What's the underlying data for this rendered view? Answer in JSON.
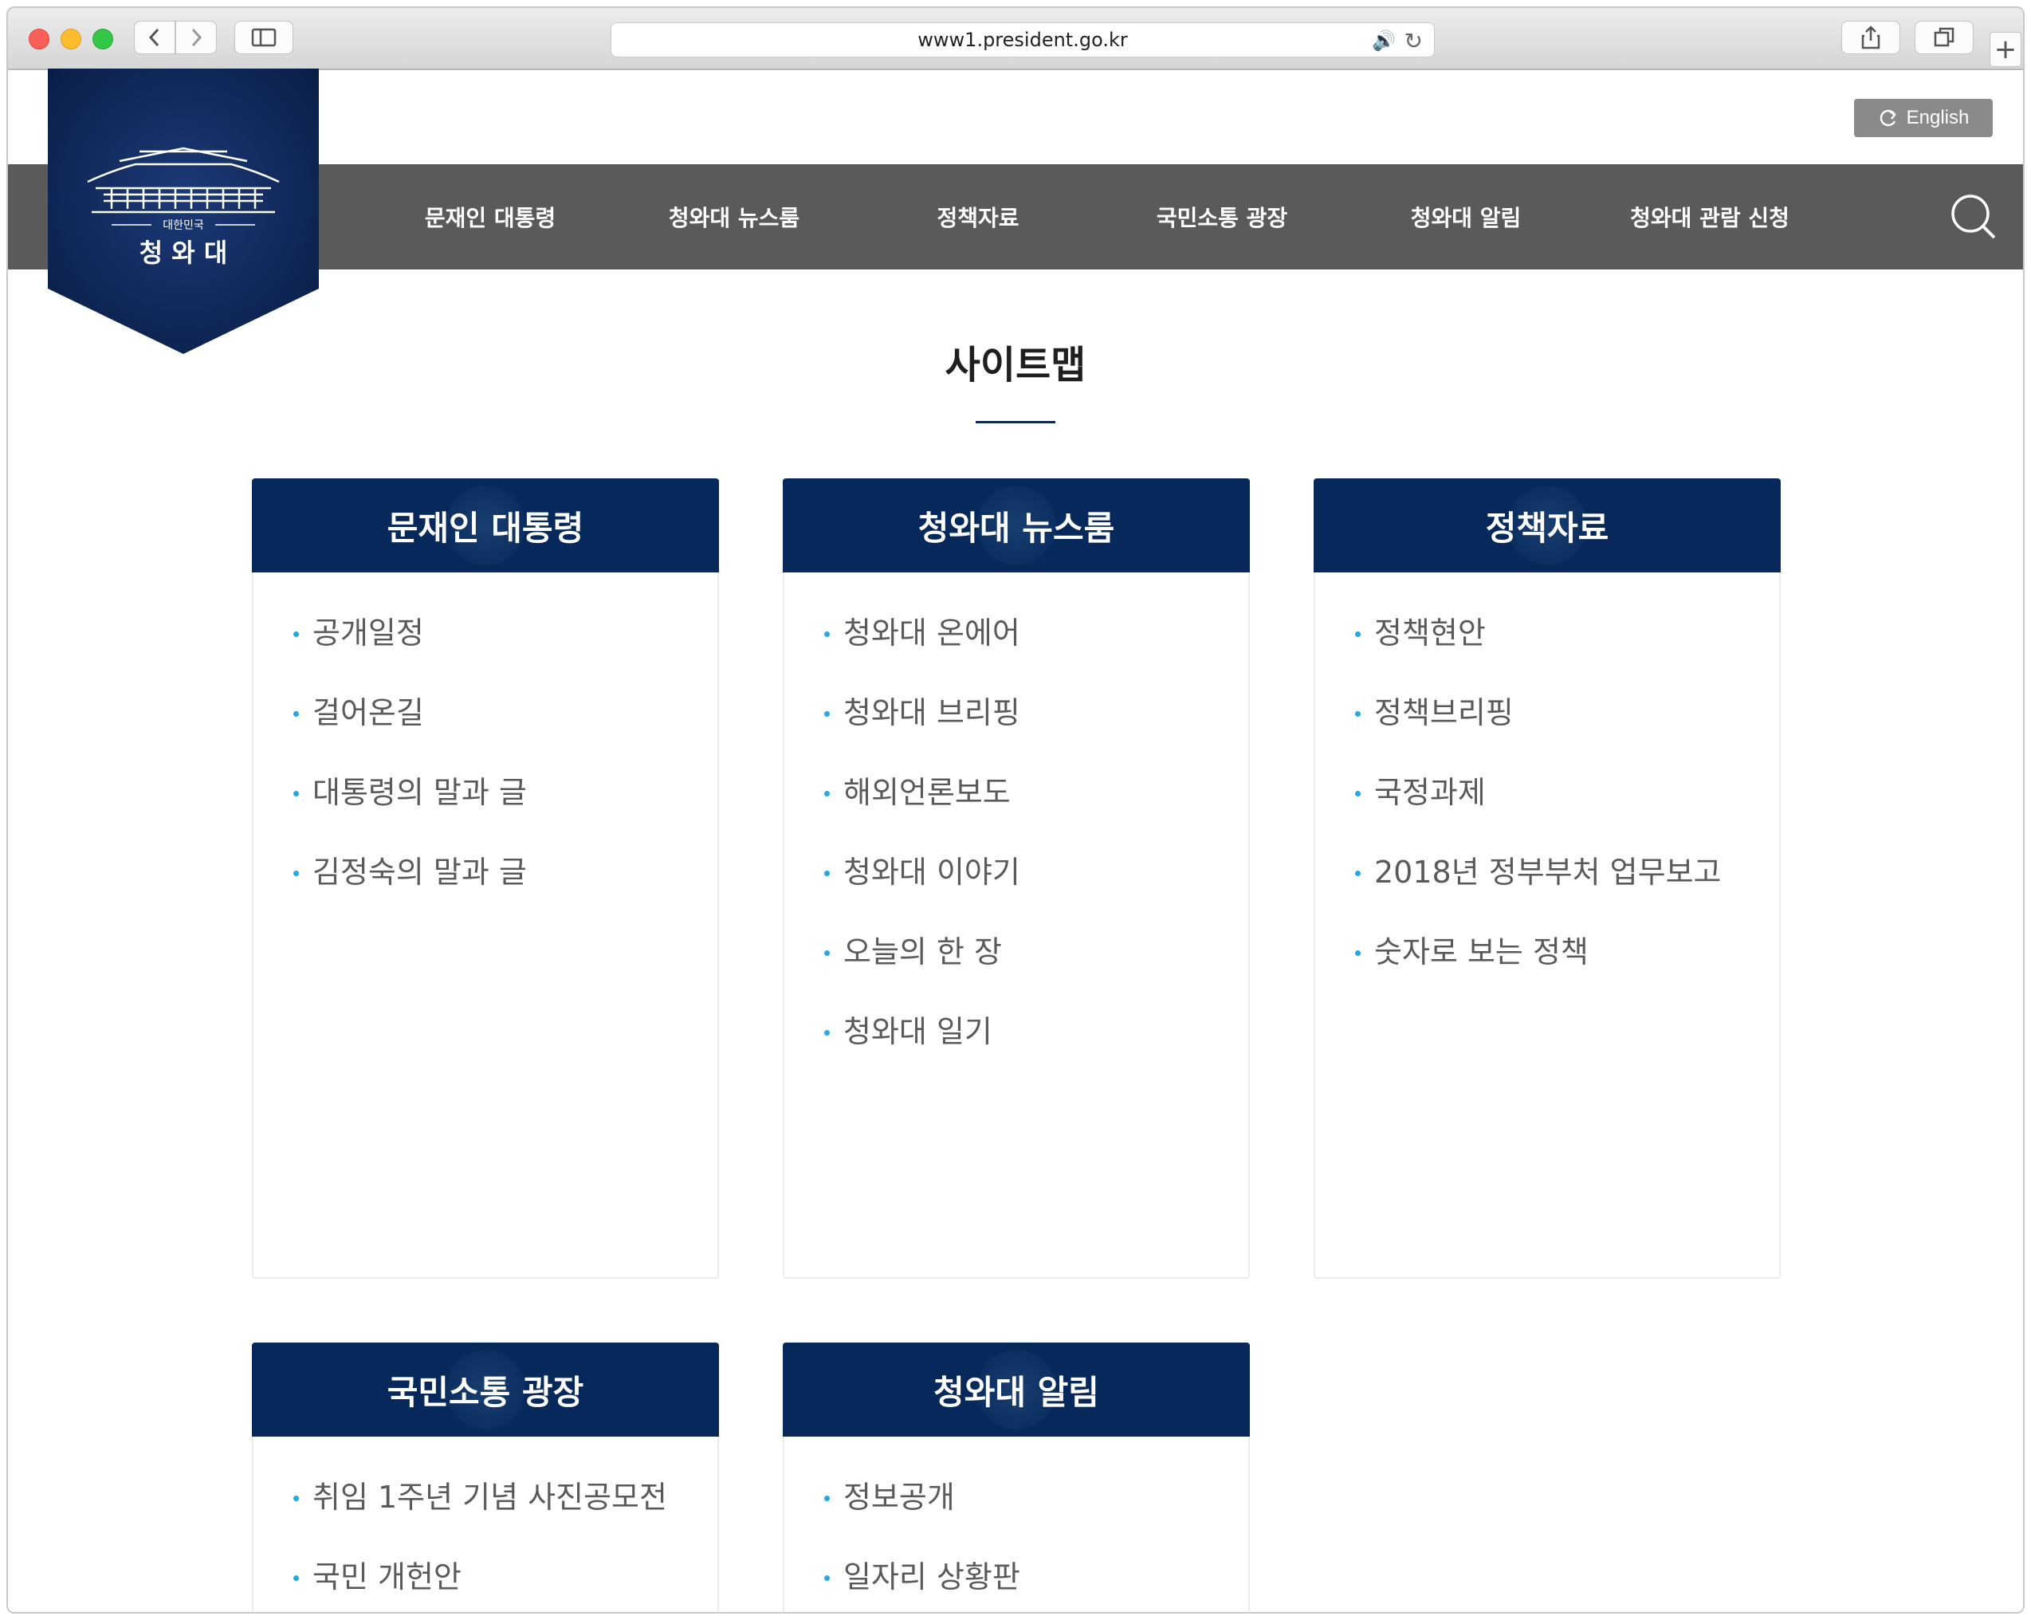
{
  "browser": {
    "url": "www1.president.go.kr"
  },
  "header": {
    "lang_button": "English",
    "logo": {
      "small_text": "대한민국",
      "name": "청 와 대"
    },
    "nav": [
      {
        "label": "문재인 대통령"
      },
      {
        "label": "청와대 뉴스룸"
      },
      {
        "label": "정책자료"
      },
      {
        "label": "국민소통 광장"
      },
      {
        "label": "청와대 알림"
      },
      {
        "label": "청와대 관람 신청"
      }
    ]
  },
  "main": {
    "title": "사이트맵",
    "sections": [
      {
        "title": "문재인 대통령",
        "items": [
          "공개일정",
          "걸어온길",
          "대통령의 말과 글",
          "김정숙의 말과 글"
        ]
      },
      {
        "title": "청와대 뉴스룸",
        "items": [
          "청와대 온에어",
          "청와대 브리핑",
          "해외언론보도",
          "청와대 이야기",
          "오늘의 한 장",
          "청와대 일기"
        ]
      },
      {
        "title": "정책자료",
        "items": [
          "정책현안",
          "정책브리핑",
          "국정과제",
          "2018년 정부부처 업무보고",
          "숫자로 보는 정책"
        ]
      },
      {
        "title": "국민소통 광장",
        "items": [
          "취임 1주년 기념 사진공모전",
          "국민 개헌안"
        ]
      },
      {
        "title": "청와대 알림",
        "items": [
          "정보공개",
          "일자리 상황판"
        ]
      }
    ]
  },
  "colors": {
    "nav_bg": "#5a5a5a",
    "card_header": "#06285a",
    "bullet": "#2ba6de",
    "logo_bg": "#0b2350"
  }
}
